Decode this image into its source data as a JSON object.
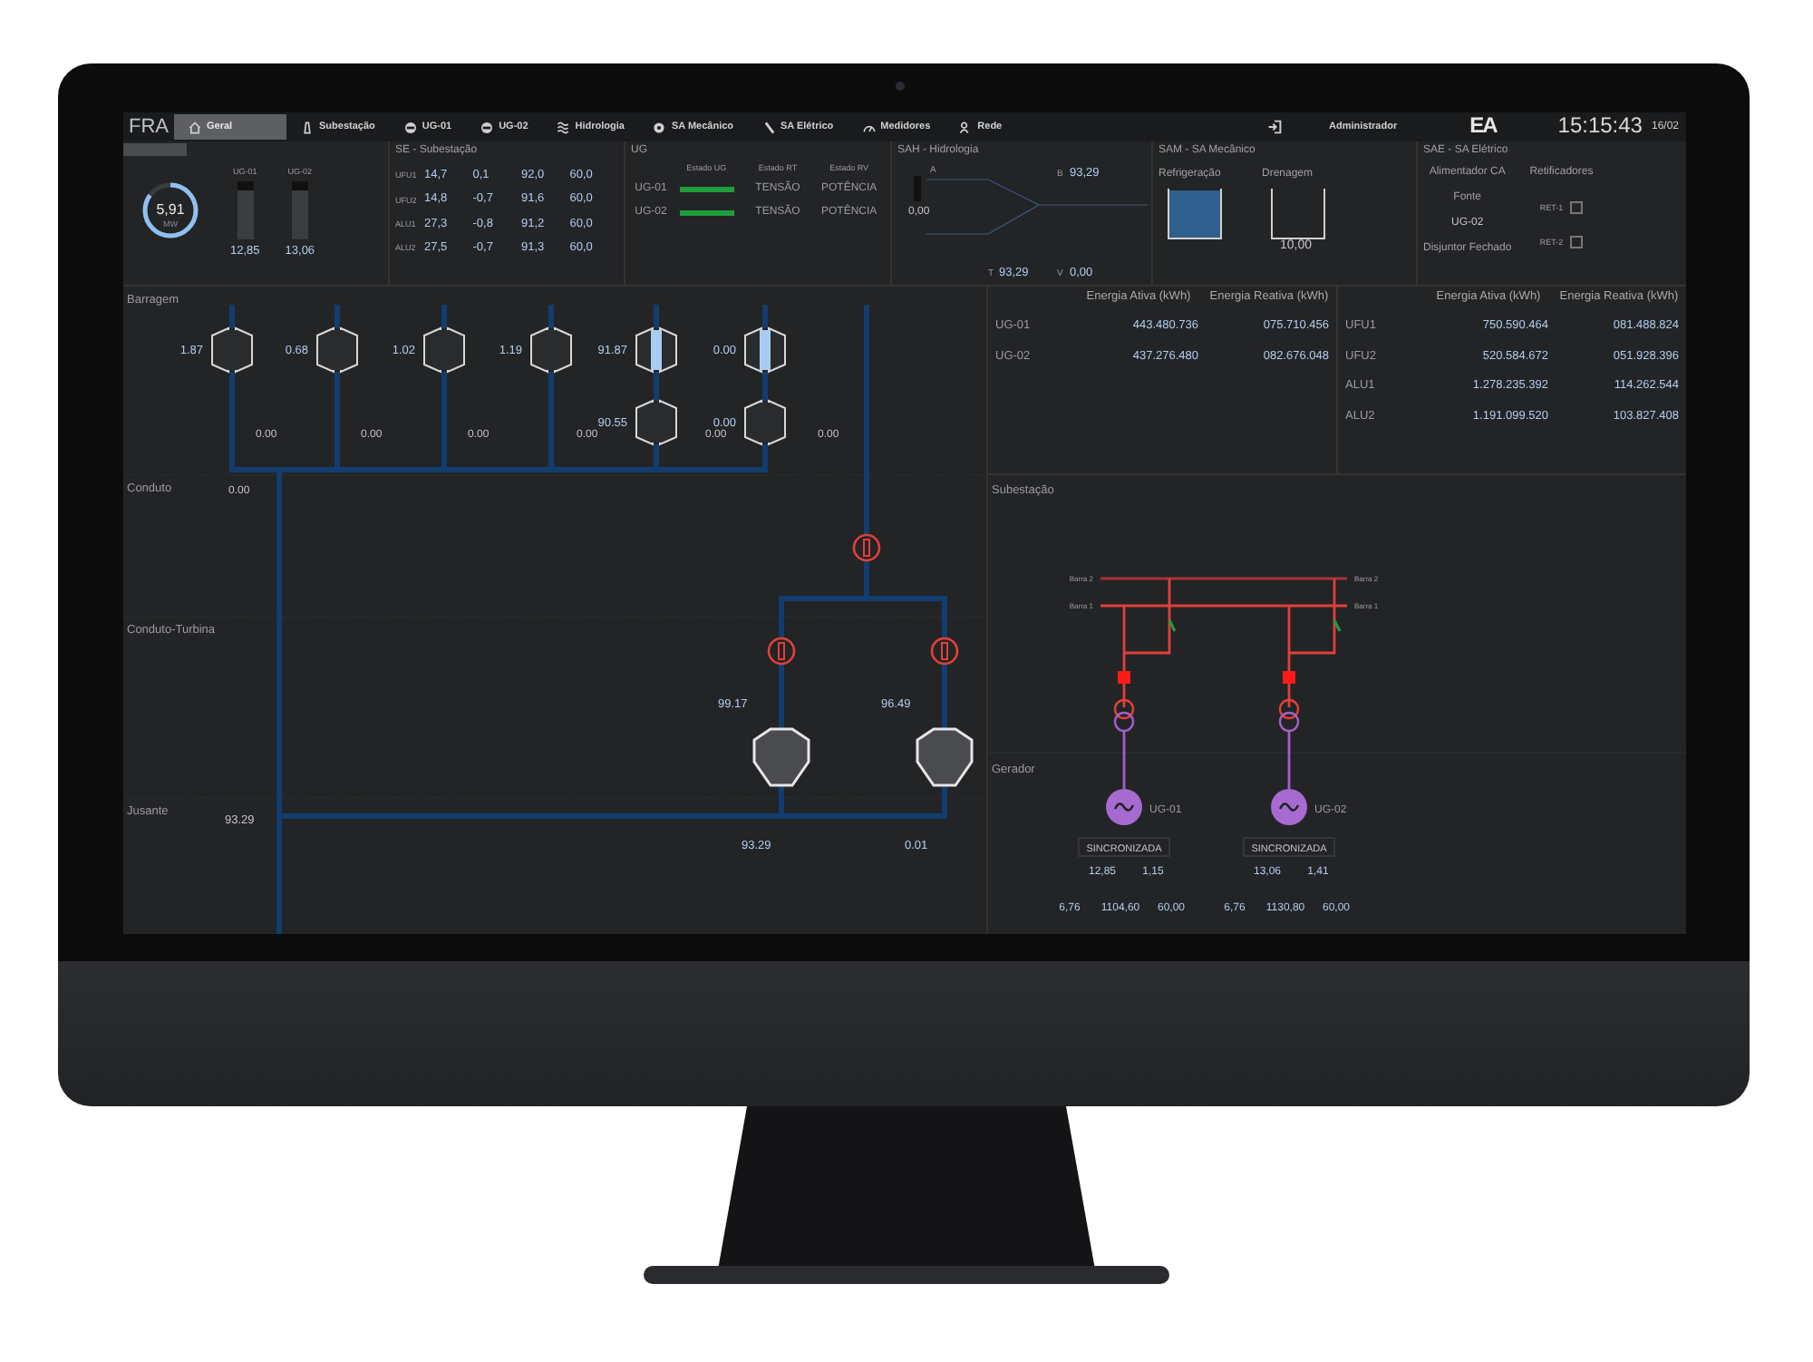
{
  "nav": {
    "brand": "FRA",
    "items": [
      {
        "label": "Geral",
        "selected": true
      },
      {
        "label": "Subestação",
        "selected": false
      },
      {
        "label": "UG-01",
        "selected": false
      },
      {
        "label": "UG-02",
        "selected": false
      },
      {
        "label": "Hidrologia",
        "selected": false
      },
      {
        "label": "SA Mecânico",
        "selected": false
      },
      {
        "label": "SA Elétrico",
        "selected": false
      },
      {
        "label": "Medidores",
        "selected": false
      },
      {
        "label": "Rede",
        "selected": false
      }
    ],
    "user": "Administrador",
    "logo": "EA",
    "time": "15:15:43",
    "date": "16/02"
  },
  "geral": {
    "gauge": {
      "value": "5,91",
      "unit": "MW",
      "level": 0.85
    },
    "bars": [
      {
        "label": "UG-01",
        "value": "12,85",
        "level": 0.85
      },
      {
        "label": "UG-02",
        "value": "13,06",
        "level": 0.85
      }
    ]
  },
  "se": {
    "title": "SE - Subestação",
    "rows": [
      {
        "label": "UFU1",
        "values": [
          "14,7",
          "0,1",
          "92,0",
          "60,0"
        ]
      },
      {
        "label": "UFU2",
        "values": [
          "14,8",
          "-0,7",
          "91,6",
          "60,0"
        ]
      },
      {
        "label": "ALU1",
        "values": [
          "27,3",
          "-0,8",
          "91,2",
          "60,0"
        ]
      },
      {
        "label": "ALU2",
        "values": [
          "27,5",
          "-0,7",
          "91,3",
          "60,0"
        ]
      }
    ]
  },
  "ug": {
    "title": "UG",
    "columns": [
      "Estado UG",
      "Estado RT",
      "Estado RV"
    ],
    "rows": [
      {
        "name": "UG-01",
        "color": "#1f9d3a",
        "rt": "TENSÃO",
        "rv": "POTÊNCIA"
      },
      {
        "name": "UG-02",
        "color": "#1f9d3a",
        "rt": "TENSÃO",
        "rv": "POTÊNCIA"
      }
    ]
  },
  "sah": {
    "title": "SAH - Hidrologia",
    "label_a": "A",
    "level_value": "0,00",
    "top_label": "B",
    "top_value": "93,29",
    "t_label": "T",
    "t_value": "93,29",
    "v_label": "V",
    "v_value": "0,00"
  },
  "sam": {
    "title": "SAM - SA Mecânico",
    "tanks": [
      {
        "label": "Refrigeração",
        "level": 0.95
      },
      {
        "label": "Drenagem",
        "value": "10,00"
      }
    ]
  },
  "sae": {
    "title": "SAE - SA Elétrico",
    "alimentador": "Alimentador CA",
    "fonte_label": "Fonte",
    "fonte_value": "UG-02",
    "disjuntor": "Disjuntor Fechado",
    "retificadores": "Retificadores",
    "rets": [
      "RET-1",
      "RET-2"
    ]
  },
  "energy": [
    {
      "headers": [
        "Energia Ativa (kWh)",
        "Energia Reativa (kWh)"
      ],
      "rows": [
        {
          "name": "UG-01",
          "active": "443.480.736",
          "reactive": "075.710.456"
        },
        {
          "name": "UG-02",
          "active": "437.276.480",
          "reactive": "082.676.048"
        }
      ]
    },
    {
      "headers": [
        "Energia Ativa (kWh)",
        "Energia Reativa (kWh)"
      ],
      "rows": [
        {
          "name": "UFU1",
          "active": "750.590.464",
          "reactive": "081.488.824"
        },
        {
          "name": "UFU2",
          "active": "520.584.672",
          "reactive": "051.928.396"
        },
        {
          "name": "ALU1",
          "active": "1.278.235.392",
          "reactive": "114.262.544"
        },
        {
          "name": "ALU2",
          "active": "1.191.099.520",
          "reactive": "103.827.408"
        }
      ]
    }
  ],
  "hydro": {
    "sections": [
      "Barragem",
      "Conduto",
      "Conduto-Turbina",
      "Jusante"
    ],
    "gates": [
      {
        "value": "1.87",
        "open": false
      },
      {
        "value": "0.68",
        "open": false
      },
      {
        "value": "1.02",
        "open": false
      },
      {
        "value": "1.19",
        "open": false
      },
      {
        "value": "91.87",
        "open": true
      },
      {
        "value": "0.00",
        "open": true
      },
      {
        "value": "90.55",
        "open": false
      },
      {
        "value": "0.00",
        "open": false
      }
    ],
    "flows": [
      "0.00",
      "0.00",
      "0.00",
      "0.00",
      "0.00",
      "0.00"
    ],
    "conduto_value": "0.00",
    "jusante_value": "93.29",
    "turbines": [
      {
        "value": "99.17",
        "outflow": "93.29"
      },
      {
        "value": "96.49",
        "outflow": "0.01"
      }
    ]
  },
  "substation": {
    "title": "Subestação",
    "gerador_title": "Gerador",
    "buses": [
      {
        "label_left": "Barra 2",
        "label_right": "Barra 2"
      },
      {
        "label_left": "Barra 1",
        "label_right": "Barra 1"
      }
    ],
    "units": [
      {
        "name": "UG-01",
        "status": "SINCRONIZADA",
        "readings": [
          "12,85",
          "1,15"
        ],
        "lines": [
          "6,76",
          "1104,60",
          "60,00"
        ]
      },
      {
        "name": "UG-02",
        "status": "SINCRONIZADA",
        "readings": [
          "13,06",
          "1,41"
        ],
        "lines": [
          "6,76",
          "1130,80",
          "60,00"
        ]
      }
    ]
  }
}
